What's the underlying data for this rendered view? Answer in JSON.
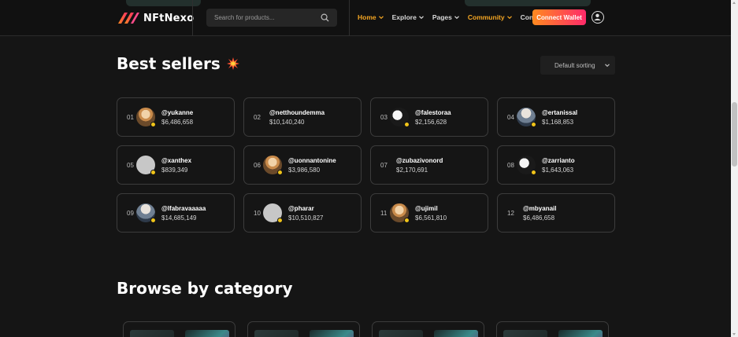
{
  "header": {
    "logo_text": "NFtNexo",
    "search_placeholder": "Search for products...",
    "nav": [
      {
        "label": "Home",
        "has_chevron": true,
        "active": true
      },
      {
        "label": "Explore",
        "has_chevron": true
      },
      {
        "label": "Pages",
        "has_chevron": true
      },
      {
        "label": "Community",
        "has_chevron": true,
        "highlight": true
      },
      {
        "label": "Contact",
        "has_chevron": false
      }
    ],
    "connect_label": "Connect Wallet",
    "user_icon": "user-circle-icon"
  },
  "best_sellers": {
    "title": "Best sellers",
    "title_icon": "burst-icon",
    "sort_label": "Default sorting",
    "sellers": [
      {
        "rank": "01",
        "user": "@yukanne",
        "amount": "$6,486,658",
        "avatar": "photo",
        "verified": true
      },
      {
        "rank": "02",
        "user": "@netthoundemma",
        "amount": "$10,140,240",
        "avatar": "none",
        "verified": false
      },
      {
        "rank": "03",
        "user": "@falestoraa",
        "amount": "$2,156,628",
        "avatar": "photo-dark",
        "verified": true
      },
      {
        "rank": "04",
        "user": "@ertanissal",
        "amount": "$1,168,853",
        "avatar": "photo-light",
        "verified": true
      },
      {
        "rank": "05",
        "user": "@xanthex",
        "amount": "$839,349",
        "avatar": "placeholder",
        "verified": true
      },
      {
        "rank": "06",
        "user": "@uonnantonine",
        "amount": "$3,986,580",
        "avatar": "photo",
        "verified": true
      },
      {
        "rank": "07",
        "user": "@zubazivonord",
        "amount": "$2,170,691",
        "avatar": "none",
        "verified": false
      },
      {
        "rank": "08",
        "user": "@zarrianto",
        "amount": "$1,643,063",
        "avatar": "photo-dark",
        "verified": true
      },
      {
        "rank": "09",
        "user": "@lfabravaaaaa",
        "amount": "$14,685,149",
        "avatar": "photo-light",
        "verified": true
      },
      {
        "rank": "10",
        "user": "@pharar",
        "amount": "$10,510,827",
        "avatar": "placeholder",
        "verified": true
      },
      {
        "rank": "11",
        "user": "@ujimil",
        "amount": "$6,561,810",
        "avatar": "photo",
        "verified": true
      },
      {
        "rank": "12",
        "user": "@mbyanail",
        "amount": "$6,486,658",
        "avatar": "none",
        "verified": false
      }
    ]
  },
  "browse": {
    "title": "Browse by category"
  },
  "colors": {
    "background": "#151515",
    "accent": "#f5a623",
    "button_start": "#ff8a1f",
    "button_end": "#ff2a6a",
    "card_border": "#3c3c3c",
    "verified": "#f0c419"
  }
}
